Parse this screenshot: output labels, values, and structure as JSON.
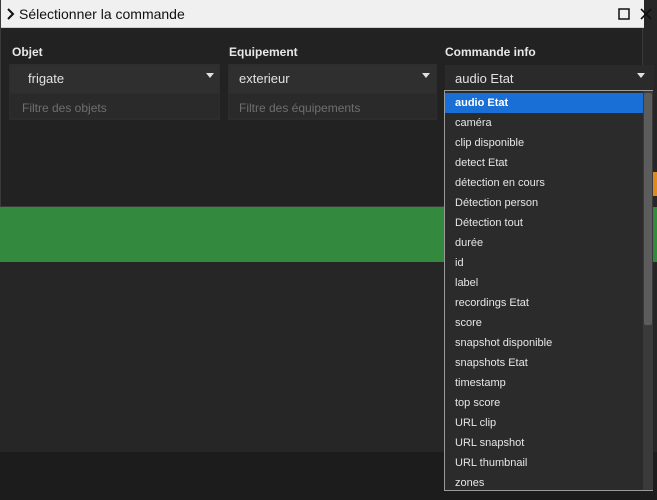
{
  "dialog": {
    "title": "Sélectionner la commande",
    "columns": {
      "object": {
        "header": "Objet",
        "value": "frigate",
        "filter_placeholder": "Filtre des objets"
      },
      "equipment": {
        "header": "Equipement",
        "value": "exterieur",
        "filter_placeholder": "Filtre des équipements"
      },
      "command": {
        "header": "Commande info",
        "value": "audio Etat"
      }
    },
    "dropdown": {
      "options": [
        "audio Etat",
        "caméra",
        "clip disponible",
        "detect Etat",
        "détection en cours",
        "Détection person",
        "Détection tout",
        "durée",
        "id",
        "label",
        "recordings Etat",
        "score",
        "snapshot disponible",
        "snapshots Etat",
        "timestamp",
        "top score",
        "URL clip",
        "URL snapshot",
        "URL thumbnail",
        "zones"
      ],
      "selected": "audio Etat"
    }
  },
  "colors": {
    "selection": "#1a6fd6",
    "background_green": "#33893d",
    "accent_orange": "#e08a1e"
  }
}
